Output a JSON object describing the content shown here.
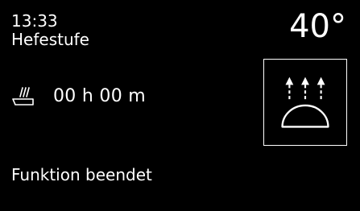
{
  "header": {
    "time": "13:33",
    "mode": "Hefestufe",
    "temperature": "40°"
  },
  "duration": {
    "icon": "pan-with-heat-icon",
    "value": "00 h 00 m"
  },
  "function": {
    "icon": "proofing-dome-with-up-arrows-icon"
  },
  "status": {
    "text": "Funktion beendet"
  },
  "colors": {
    "background": "#000000",
    "foreground": "#ffffff"
  }
}
